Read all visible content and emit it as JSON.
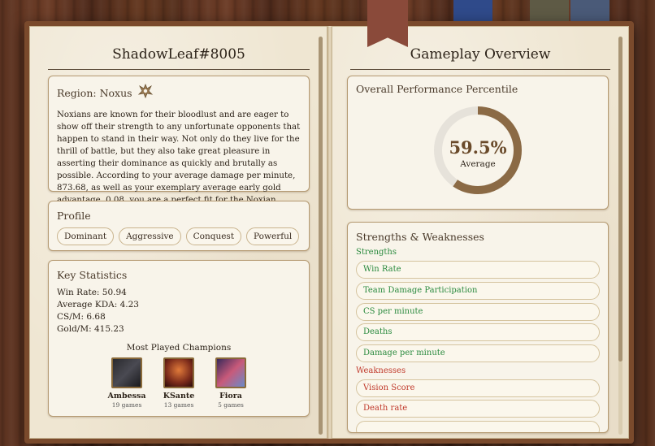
{
  "left_page": {
    "title": "ShadowLeaf#8005",
    "region": {
      "title": "Region: Noxus",
      "icon": "noxus-crest-icon",
      "description": "Noxians are known for their bloodlust and are eager to show off their strength to any unfortunate opponents that happen to stand in their way. Not only do they live for the thrill of battle, but they also take great pleasure in asserting their dominance as quickly and brutally as possible. According to your average damage per minute, 873.68, as well as your exemplary average early gold advantage, 0.08, you are a perfect fit for the Noxian archetype."
    },
    "profile": {
      "title": "Profile",
      "tags": [
        "Dominant",
        "Aggressive",
        "Conquest",
        "Powerful"
      ]
    },
    "key_statistics": {
      "title": "Key Statistics",
      "stats": [
        "Win Rate: 50.94",
        "Average KDA: 4.23",
        "CS/M: 6.68",
        "Gold/M: 415.23"
      ],
      "most_played_title": "Most Played Champions",
      "champions": [
        {
          "name": "Ambessa",
          "games": "19 games",
          "icon": "ambessa-portrait"
        },
        {
          "name": "KSante",
          "games": "13 games",
          "icon": "ksante-portrait"
        },
        {
          "name": "Fiora",
          "games": "5 games",
          "icon": "fiora-portrait"
        }
      ]
    }
  },
  "right_page": {
    "title": "Gameplay Overview",
    "performance": {
      "title": "Overall Performance Percentile",
      "value": "59.5%",
      "value_fraction": 0.595,
      "label": "Average",
      "ring_color": "#8b6a45",
      "track_color": "#e6e2da"
    },
    "strengths_weaknesses": {
      "title": "Strengths & Weaknesses",
      "strengths_label": "Strengths",
      "strengths": [
        "Win Rate",
        "Team Damage Participation",
        "CS per minute",
        "Deaths",
        "Damage per minute"
      ],
      "weaknesses_label": "Weaknesses",
      "weaknesses": [
        "Vision Score",
        "Death rate"
      ]
    }
  },
  "colors": {
    "strength": "#2a8a3e",
    "weakness": "#c0392b",
    "ribbon_red": "#8a4a3a",
    "tab_blue": "#2f4a8a",
    "tab_olive": "#5e5a45",
    "tab_slate": "#4a5a78"
  }
}
